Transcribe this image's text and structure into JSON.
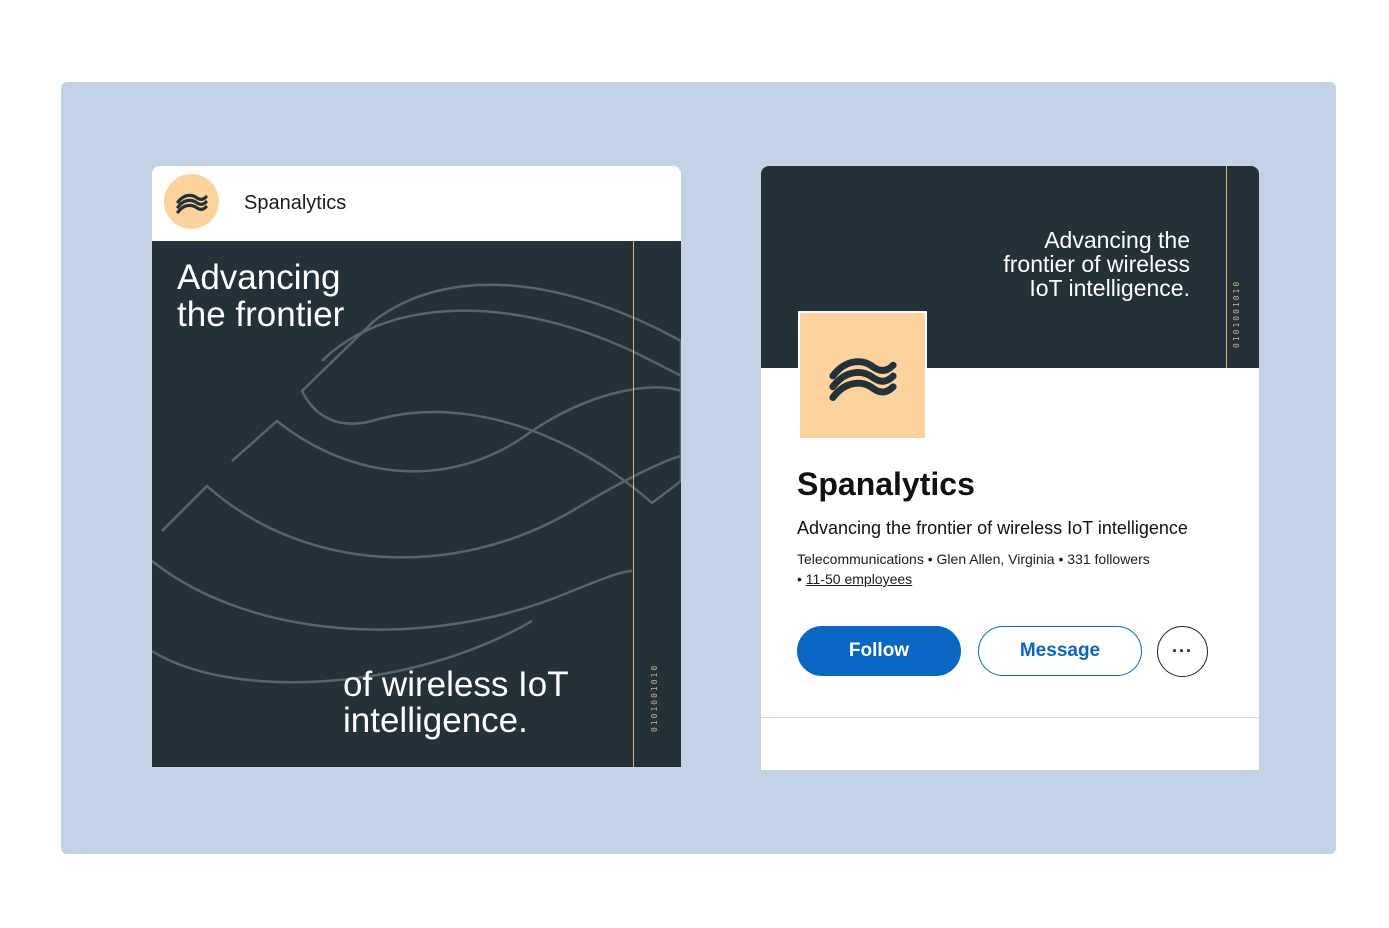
{
  "colors": {
    "stage_bg": "#c3d2e7",
    "dark_panel": "#243139",
    "accent_peach": "#fdd39d",
    "accent_line": "#d7b575",
    "linkedin_blue": "#0a66c2"
  },
  "post": {
    "author_name": "Spanalytics",
    "avatar_icon": "spanalytics-logo-icon",
    "image": {
      "headline": "Advancing\nthe frontier",
      "tagline": "of wireless IoT\nintelligence.",
      "binary": "0101001010"
    }
  },
  "profile": {
    "cover": {
      "text": "Advancing the\nfrontier of wireless\nIoT intelligence.",
      "binary": "0101001010"
    },
    "logo_icon": "spanalytics-logo-icon",
    "company_name": "Spanalytics",
    "headline": "Advancing the frontier of wireless IoT intelligence",
    "meta": {
      "industry": "Telecommunications",
      "location": "Glen Allen, Virginia",
      "followers": "331 followers",
      "employees": "11-50 employees"
    },
    "buttons": {
      "follow": "Follow",
      "message": "Message",
      "more": "···"
    }
  }
}
